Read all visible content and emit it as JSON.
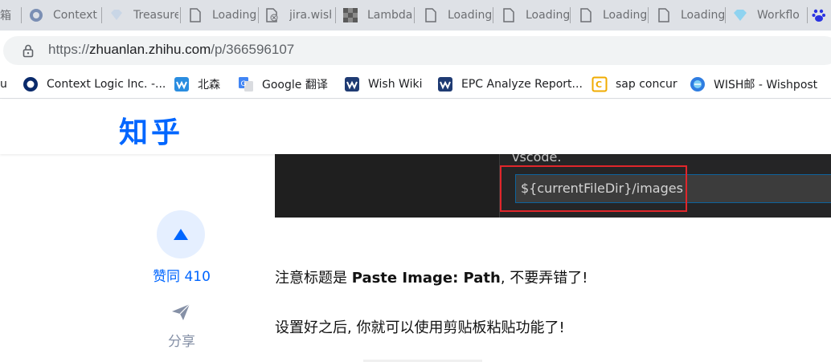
{
  "tabs": [
    {
      "title": "箱",
      "icon": "mailbox-icon"
    },
    {
      "title": "Context",
      "icon": "circle-favicon-icon"
    },
    {
      "title": "Treasure",
      "icon": "gem-icon"
    },
    {
      "title": "Loading",
      "icon": "page-icon"
    },
    {
      "title": "jira.wish",
      "icon": "page-error-icon"
    },
    {
      "title": "Lambda",
      "icon": "checker-icon"
    },
    {
      "title": "Loading",
      "icon": "page-icon"
    },
    {
      "title": "Loading",
      "icon": "page-icon"
    },
    {
      "title": "Loading",
      "icon": "page-icon"
    },
    {
      "title": "Loading",
      "icon": "page-icon"
    },
    {
      "title": "Workflo",
      "icon": "diamond-icon"
    }
  ],
  "address": {
    "host": "zhuanlan.zhihu.com",
    "path": "/p/366596107"
  },
  "bookmarks": [
    {
      "label": "u",
      "icon": ""
    },
    {
      "label": "Context Logic Inc. -...",
      "icon": "context-logic-icon"
    },
    {
      "label": "北森",
      "icon": "beisen-icon"
    },
    {
      "label": "Google 翻译",
      "icon": "google-translate-icon"
    },
    {
      "label": "Wish Wiki",
      "icon": "wish-icon"
    },
    {
      "label": "EPC Analyze Report...",
      "icon": "wish-icon"
    },
    {
      "label": "sap concur",
      "icon": "concur-icon"
    },
    {
      "label": "WISH邮 - Wishpost",
      "icon": "wishpost-icon"
    }
  ],
  "zhihu": {
    "logo": "知乎"
  },
  "code_image": {
    "caption": "vscode.",
    "input_value": "${currentFileDir}/images"
  },
  "sidebar": {
    "vote_label": "赞同 410",
    "share_label": "分享"
  },
  "article": {
    "p1_before": "注意标题是 ",
    "p1_bold": "Paste Image: Path",
    "p1_after": ", 不要弄错了!",
    "p2": "设置好之后, 你就可以使用剪贴板粘贴功能了!"
  },
  "colors": {
    "zhihu_blue": "#0066ff",
    "highlight_red": "#e0262b"
  }
}
